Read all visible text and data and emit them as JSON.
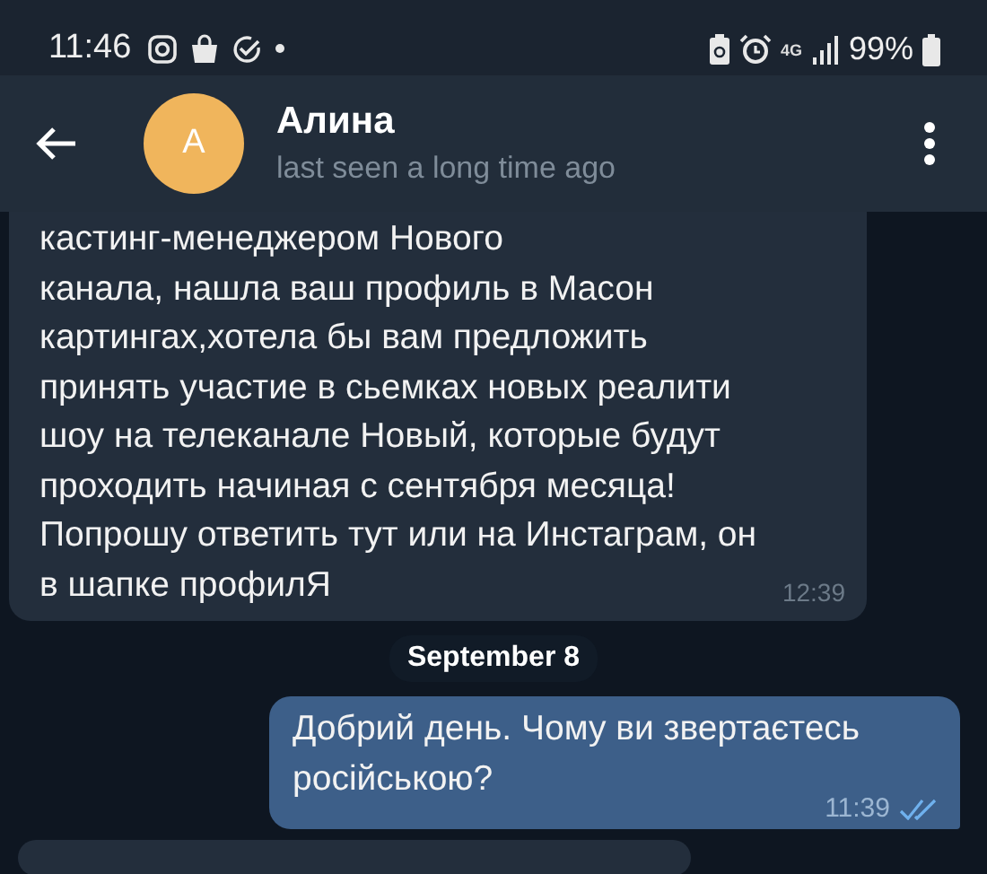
{
  "status_bar": {
    "time": "11:46",
    "battery": "99%",
    "network": "4G"
  },
  "header": {
    "avatar_letter": "А",
    "name": "Алина",
    "status": "last seen a long time ago"
  },
  "messages": [
    {
      "kind": "incoming",
      "lines": [
        "кастинг-менеджером Нового",
        "канала, нашла ваш профиль в Масон",
        "картингах,хотела бы вам предложить",
        "принять участие в сьемках новых реалити",
        "шоу на телеканале Новый, которые будут",
        "проходить начиная с сентября месяца!",
        "Попрошу ответить тут или на Инстаграм, он",
        "в шапке профилЯ"
      ],
      "time": "12:39"
    },
    {
      "kind": "date",
      "text": "September 8"
    },
    {
      "kind": "outgoing",
      "lines": [
        "Добрий день. Чому ви звертаєтесь",
        "російською?"
      ],
      "time": "11:39",
      "read": true
    },
    {
      "kind": "incoming_partial"
    }
  ]
}
